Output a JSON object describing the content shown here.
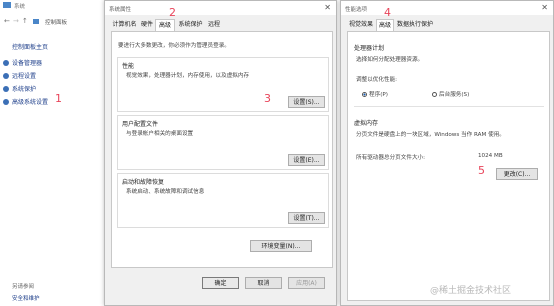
{
  "control_panel": {
    "title": "系统",
    "address_text": "控制面板",
    "home_link": "控制面板主页",
    "nav": [
      {
        "label": "设备管理器",
        "icon": "shield-icon"
      },
      {
        "label": "远程设置",
        "icon": "shield-icon"
      },
      {
        "label": "系统保护",
        "icon": "shield-icon"
      },
      {
        "label": "高级系统设置",
        "icon": "shield-icon"
      }
    ],
    "see_also": "另请参阅",
    "security_link": "安全和维护"
  },
  "system_properties": {
    "title": "系统属性",
    "tabs": [
      "计算机名",
      "硬件",
      "高级",
      "系统保护",
      "远程"
    ],
    "active_tab": "高级",
    "admin_note": "要进行大多数更改，你必须作为管理员登录。",
    "performance": {
      "title": "性能",
      "desc": "视觉效果，处理器计划，内存使用，以及虚拟内存",
      "button": "设置(S)..."
    },
    "user_profiles": {
      "title": "用户配置文件",
      "desc": "与登录帐户相关的桌面设置",
      "button": "设置(E)..."
    },
    "startup_recovery": {
      "title": "启动和故障恢复",
      "desc": "系统启动、系统故障和调试信息",
      "button": "设置(T)..."
    },
    "env_button": "环境变量(N)...",
    "ok": "确定",
    "cancel": "取消",
    "apply": "应用(A)"
  },
  "performance_options": {
    "title": "性能选项",
    "tabs": [
      "视觉效果",
      "高级",
      "数据执行保护"
    ],
    "active_tab": "高级",
    "processor": {
      "title": "处理器计划",
      "desc": "选择如何分配处理器资源。",
      "adjust_label": "调整以优化性能:",
      "options": [
        "程序(P)",
        "后台服务(S)"
      ],
      "selected": "程序(P)"
    },
    "virtual_memory": {
      "title": "虚拟内存",
      "desc": "分页文件是硬盘上的一块区域，Windows 当作 RAM 使用。",
      "total_label": "所有驱动器总分页文件大小:",
      "total_value": "1024 MB",
      "change_button": "更改(C)..."
    }
  },
  "steps": [
    "1",
    "2",
    "3",
    "4",
    "5"
  ],
  "watermark": "@稀土掘金技术社区",
  "colors": {
    "step": "#e8445a",
    "link": "#1e3f8a",
    "accent": "#1a5fb4"
  }
}
